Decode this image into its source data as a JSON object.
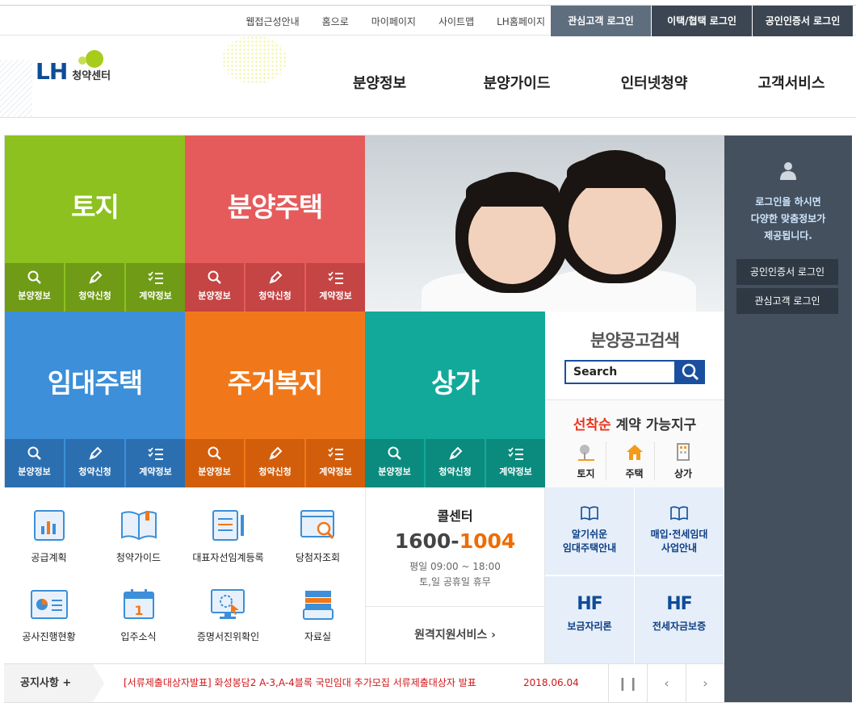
{
  "topbar": {
    "links": [
      "웹접근성안내",
      "홈으로",
      "마이페이지",
      "사이트맵",
      "LH홈페이지"
    ],
    "btn_customer": "관심고객 로그인",
    "btn_partner": "이택/협택 로그인",
    "btn_cert": "공인인증서 로그인"
  },
  "logo": {
    "brand": "LH",
    "sub": "청약센터"
  },
  "gnb": [
    "분양정보",
    "분양가이드",
    "인터넷청약",
    "고객서비스"
  ],
  "tiles": [
    {
      "title": "토지",
      "subs": [
        "분양정보",
        "청약신청",
        "계약정보"
      ],
      "color": "#8cc11f",
      "bar": "#6f9b16"
    },
    {
      "title": "분양주택",
      "subs": [
        "분양정보",
        "청약신청",
        "계약정보"
      ],
      "color": "#e55b5b",
      "bar": "#c54444"
    },
    {
      "title": "임대주택",
      "subs": [
        "분양정보",
        "청약신청",
        "계약정보"
      ],
      "color": "#3c8fd8",
      "bar": "#2b6fb1"
    },
    {
      "title": "주거복지",
      "subs": [
        "분양정보",
        "청약신청",
        "계약정보"
      ],
      "color": "#f0781a",
      "bar": "#d25e0b"
    },
    {
      "title": "상가",
      "subs": [
        "분양정보",
        "청약신청",
        "계약정보"
      ],
      "color": "#12a99a",
      "bar": "#0b8b7e"
    }
  ],
  "side": {
    "msg1": "로그인을 하시면",
    "msg2": "다양한 맞춤정보가",
    "msg3": "제공됩니다.",
    "btn_cert": "공인인증서 로그인",
    "btn_customer": "관심고객 로그인"
  },
  "search": {
    "title": "분양공고검색",
    "placeholder": "Search"
  },
  "firstcome": {
    "title_hl": "선착순",
    "title_rest": " 계약 가능지구",
    "items": [
      "토지",
      "주택",
      "상가"
    ]
  },
  "quick": [
    "공급계획",
    "청약가이드",
    "대표자선임계등록",
    "당첨자조회",
    "공사진행현황",
    "입주소식",
    "증명서진위확인",
    "자료실"
  ],
  "call": {
    "title": "콜센터",
    "num_a": "1600-",
    "num_b": "1004",
    "hours1": "평일 09:00 ~ 18:00",
    "hours2": "토,일 공휴일 휴무",
    "remote": "원격지원서비스 ›"
  },
  "grid4": {
    "a1": "알기쉬운",
    "a2": "임대주택안내",
    "b1": "매입·전세임대",
    "b2": "사업안내",
    "c": "보금자리론",
    "d": "전세자금보증",
    "hf": "HF"
  },
  "notice": {
    "label": "공지사항  +",
    "text": "[서류제출대상자발표] 화성봉담2 A-3,A-4블록 국민임대 추가모집 서류제출대상자 발표",
    "date": "2018.06.04"
  }
}
